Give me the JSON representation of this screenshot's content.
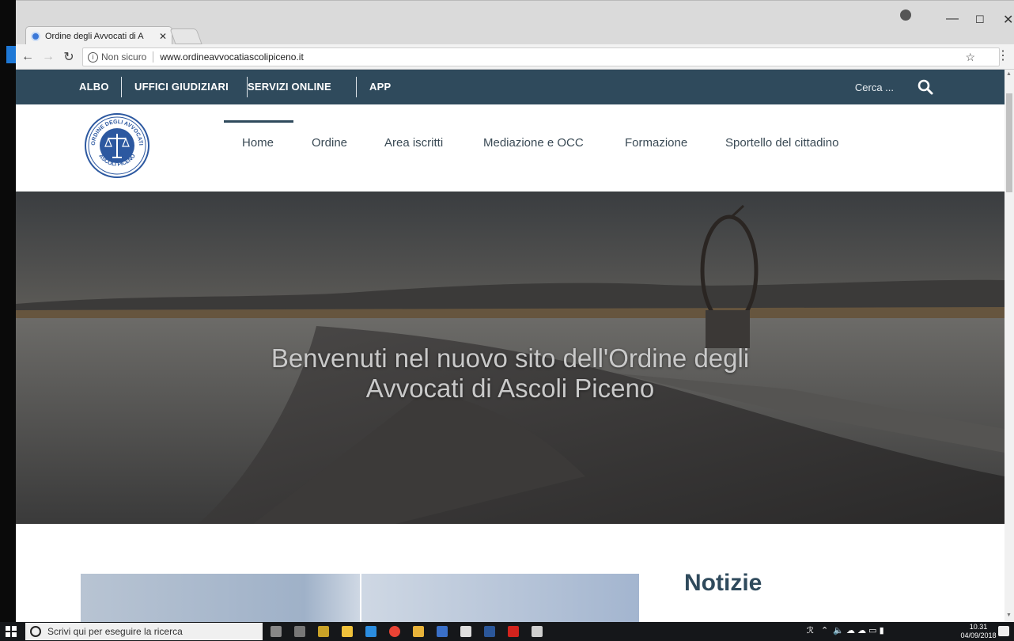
{
  "browser": {
    "tab_title": "Ordine degli Avvocati di A",
    "address_insecure_label": "Non sicuro",
    "address_url": "www.ordineavvocatiascolipiceno.it"
  },
  "site": {
    "topbar": {
      "items": [
        "ALBO",
        "UFFICI GIUDIZIARI",
        "SERVIZI ONLINE",
        "APP"
      ],
      "search_placeholder": "Cerca ..."
    },
    "logo_text": {
      "top": "ORDINE DEGLI AVVOCATI",
      "bottom": "ASCOLI PICENO"
    },
    "nav": [
      "Home",
      "Ordine",
      "Area iscritti",
      "Mediazione e OCC",
      "Formazione",
      "Sportello del cittadino"
    ],
    "active_nav": "Home",
    "hero": {
      "line1": "Benvenuti nel nuovo sito dell'Ordine degli",
      "line2": "Avvocati di Ascoli Piceno"
    },
    "news_heading": "Notizie"
  },
  "taskbar": {
    "search_placeholder": "Scrivi qui per eseguire la ricerca",
    "time": "10.31",
    "date": "04/09/2018"
  },
  "colors": {
    "topbar_bg": "#2f4a5c",
    "nav_text": "#3a4a55",
    "heading": "#2f4a5c",
    "taskbar_bg": "#15171a"
  }
}
